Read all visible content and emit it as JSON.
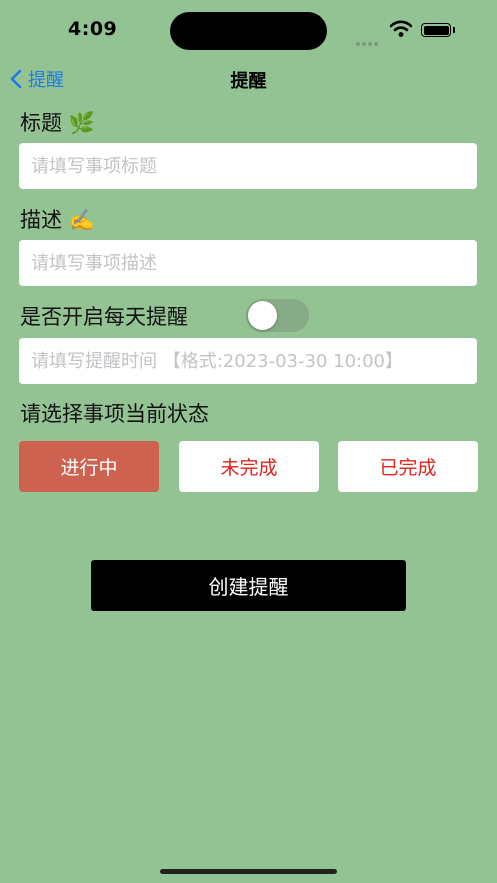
{
  "status_bar": {
    "time": "4:09"
  },
  "nav": {
    "back_label": "提醒",
    "title": "提醒"
  },
  "form": {
    "title_label": "标题 🌿",
    "title_placeholder": "请填写事项标题",
    "desc_label": "描述 ✍️",
    "desc_placeholder": "请填写事项描述",
    "daily_label": "是否开启每天提醒",
    "daily_enabled": false,
    "time_placeholder": "请填写提醒时间 【格式:2023-03-30 10:00】",
    "status_label": "请选择事项当前状态",
    "status_options": [
      "进行中",
      "未完成",
      "已完成"
    ],
    "selected_status": "进行中",
    "create_label": "创建提醒"
  },
  "colors": {
    "background": "#94c393",
    "accent": "#1f7ae6",
    "selected_status": "#cd6251",
    "status_text": "#e0241c",
    "create_button": "#000000"
  }
}
